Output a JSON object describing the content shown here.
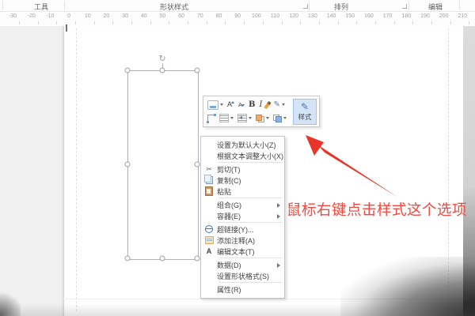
{
  "topbar": {
    "groups": [
      {
        "label": "工具",
        "launcher": false
      },
      {
        "label": "形状样式",
        "launcher": true
      },
      {
        "label": "排列",
        "launcher": true
      },
      {
        "label": "编辑",
        "launcher": false
      }
    ]
  },
  "ruler": {
    "unit_labels": [
      "-30",
      "-20",
      "-10",
      "0",
      "10",
      "20",
      "30",
      "40",
      "50",
      "60",
      "70",
      "80",
      "90",
      "100",
      "110",
      "120",
      "130",
      "140",
      "150",
      "160",
      "170",
      "180",
      "190",
      "200",
      "210"
    ]
  },
  "mini_toolbar": {
    "row1": [
      {
        "icon": "fill-style-icon",
        "glyph": "",
        "dropdown": true
      },
      {
        "icon": "grow-font-icon",
        "glyph": "A",
        "dropdown": false
      },
      {
        "icon": "shrink-font-icon",
        "glyph": "A",
        "dropdown": false
      },
      {
        "icon": "bold-icon",
        "glyph": "B",
        "dropdown": false
      },
      {
        "icon": "italic-icon",
        "glyph": "I",
        "dropdown": false
      },
      {
        "icon": "format-painter-icon",
        "glyph": "",
        "dropdown": false
      },
      {
        "icon": "change-shape-icon",
        "glyph": "✎",
        "dropdown": true
      }
    ],
    "row2": [
      {
        "icon": "connector-icon",
        "glyph": "",
        "dropdown": false
      },
      {
        "icon": "text-align-icon",
        "glyph": "",
        "dropdown": true
      },
      {
        "icon": "paragraph-icon",
        "glyph": "",
        "dropdown": true
      },
      {
        "icon": "bring-forward-icon",
        "glyph": "",
        "dropdown": true
      },
      {
        "icon": "send-backward-icon",
        "glyph": "",
        "dropdown": true
      }
    ],
    "style_button": {
      "label": "样式",
      "icon_glyph": "✎"
    }
  },
  "context_menu": {
    "items": [
      {
        "type": "item",
        "label": "设置为默认大小(Z)",
        "icon": "",
        "glyph": "",
        "submenu": false
      },
      {
        "type": "item",
        "label": "根据文本调整大小(X)",
        "icon": "",
        "glyph": "",
        "submenu": false
      },
      {
        "type": "separator"
      },
      {
        "type": "item",
        "label": "剪切(T)",
        "icon": "cut-icon",
        "glyph": "✂",
        "submenu": false
      },
      {
        "type": "item",
        "label": "复制(C)",
        "icon": "copy-icon",
        "glyph": "",
        "submenu": false
      },
      {
        "type": "item",
        "label": "粘贴",
        "icon": "paste-icon",
        "glyph": "",
        "submenu": false
      },
      {
        "type": "separator"
      },
      {
        "type": "item",
        "label": "组合(G)",
        "icon": "",
        "glyph": "",
        "submenu": true
      },
      {
        "type": "item",
        "label": "容器(E)",
        "icon": "",
        "glyph": "",
        "submenu": true
      },
      {
        "type": "separator"
      },
      {
        "type": "item",
        "label": "超链接(Y)...",
        "icon": "hyperlink-icon",
        "glyph": "",
        "submenu": false
      },
      {
        "type": "item",
        "label": "添加注释(A)",
        "icon": "comment-icon",
        "glyph": "",
        "submenu": false
      },
      {
        "type": "item",
        "label": "编辑文本(T)",
        "icon": "edit-text-icon",
        "glyph": "A",
        "submenu": false
      },
      {
        "type": "separator"
      },
      {
        "type": "item",
        "label": "数据(D)",
        "icon": "",
        "glyph": "",
        "submenu": true
      },
      {
        "type": "item",
        "label": "设置形状格式(S)",
        "icon": "",
        "glyph": "",
        "submenu": false
      },
      {
        "type": "separator"
      },
      {
        "type": "item",
        "label": "属性(R)",
        "icon": "",
        "glyph": "",
        "submenu": false
      }
    ]
  },
  "shape": {
    "rotation_glyph": "↻"
  },
  "annotation": {
    "text": "鼠标右键点击样式这个选项",
    "color": "#ef4a3f",
    "arrow_color": "#e8352a"
  }
}
